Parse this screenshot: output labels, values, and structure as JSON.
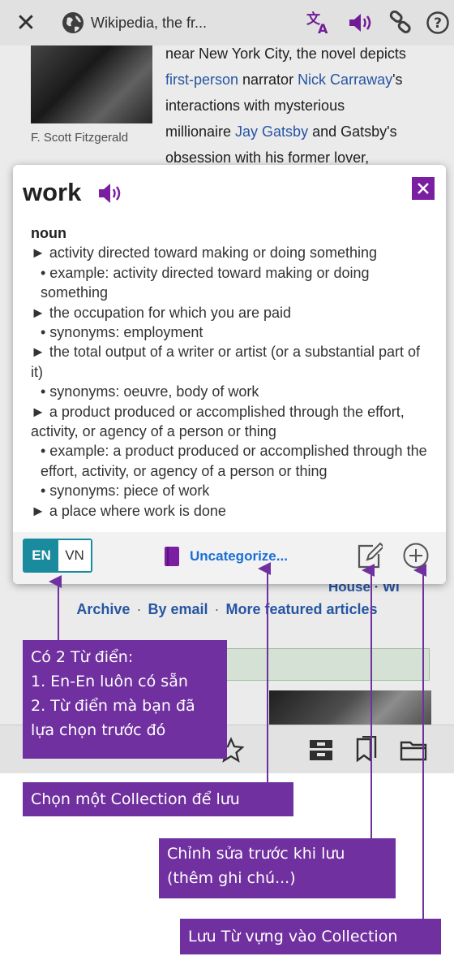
{
  "topbar": {
    "close_icon": "close-icon",
    "title": "Wikipedia, the fr...",
    "icons": [
      "globe-icon",
      "translate-icon",
      "speaker-icon",
      "link-icon",
      "help-icon"
    ],
    "icon_color": "#7b1fa2"
  },
  "article": {
    "photo_caption": "F. Scott Fitzgerald",
    "blurb": {
      "line1": "near New York City, the novel depicts",
      "link1": "first-person",
      "t2": " narrator ",
      "link2": "Nick Carraway",
      "t3": "'s",
      "line3": "interactions with mysterious",
      "t4": "millionaire ",
      "link3": "Jay Gatsby",
      "t5": " and Gatsby's",
      "line5": "obsession with his former lover,"
    },
    "partial_links": "House  ·  Wi",
    "more_links": [
      "Archive",
      "By email",
      "More featured articles"
    ],
    "separator": "·"
  },
  "popup": {
    "word": "work",
    "part_of_speech": "noun",
    "definitions": [
      {
        "kind": "def",
        "text": "► activity directed toward making or doing something"
      },
      {
        "kind": "sub",
        "text": "• example: activity directed toward making or doing something"
      },
      {
        "kind": "def",
        "text": "► the occupation for which you are paid"
      },
      {
        "kind": "sub",
        "text": "• synonyms: employment"
      },
      {
        "kind": "def",
        "text": "► the total output of a writer or artist (or a substantial part of it)"
      },
      {
        "kind": "sub",
        "text": "• synonyms: oeuvre, body of work"
      },
      {
        "kind": "def",
        "text": "► a product produced or accomplished through the effort, activity, or agency of a person or thing"
      },
      {
        "kind": "sub",
        "text": "• example: a product produced or accomplished through the effort, activity, or agency of a person or thing"
      },
      {
        "kind": "sub",
        "text": "• synonyms: piece of work"
      },
      {
        "kind": "def",
        "text": "► a place where work is done"
      }
    ],
    "lang_en": "EN",
    "lang_vn": "VN",
    "collection_label": "Uncategorize...",
    "accent_color": "#7b1fa2",
    "lang_color": "#1a8a9e",
    "link_color": "#1a6fd6"
  },
  "callouts": {
    "dict_lines": [
      "Có 2 Từ điển:",
      "1. En-En luôn có sẵn",
      "2. Từ điển mà bạn đã",
      "lựa chọn trước đó"
    ],
    "collection": "Chọn một Collection để lưu",
    "edit_lines": [
      "Chỉnh sửa trước khi lưu",
      "(thêm ghi chú...)"
    ],
    "save": "Lưu Từ vựng vào Collection",
    "color": "#7030a0"
  }
}
